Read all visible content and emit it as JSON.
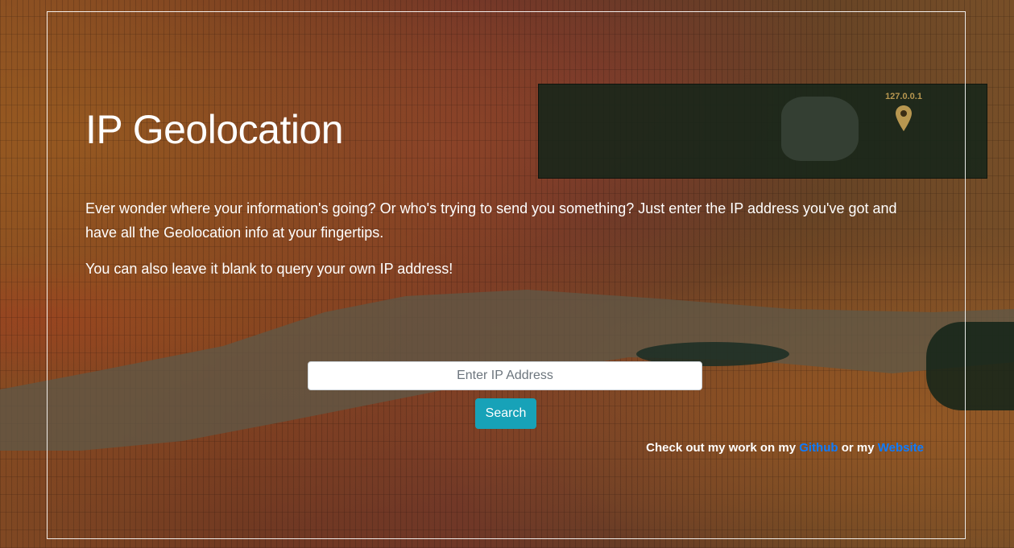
{
  "page": {
    "title": "IP Geolocation",
    "description": "Ever wonder where your information's going? Or who's trying to send you something? Just enter the IP address you've got and have all the Geolocation info at your fingertips.",
    "description_2": "You can also leave it blank to query your own IP address!"
  },
  "search": {
    "placeholder": "Enter IP Address",
    "value": "",
    "button_label": "Search",
    "button_color": "#17a2b8"
  },
  "footer": {
    "prefix": "Check out my work on my",
    "github_label": "Github",
    "connector": "or my",
    "website_label": "Website",
    "link_color": "#0d7bff"
  },
  "map_marker": {
    "label": "127.0.0.1",
    "icon": "map-pin-icon",
    "color": "#b89750"
  }
}
